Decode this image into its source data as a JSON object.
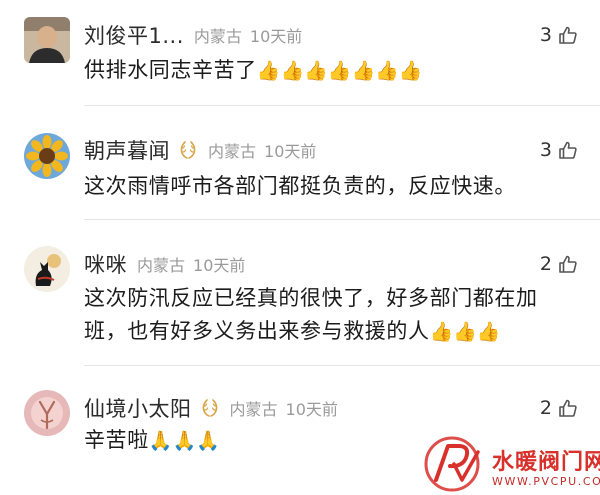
{
  "comments": [
    {
      "name": "刘俊平1...",
      "has_badge": false,
      "location": "内蒙古",
      "time": "10天前",
      "likes": "3",
      "text": "供排水同志辛苦了",
      "emoji": "👍👍👍👍👍👍👍"
    },
    {
      "name": "朝声暮闻",
      "has_badge": true,
      "location": "内蒙古",
      "time": "10天前",
      "likes": "3",
      "text": "这次雨情呼市各部门都挺负责的，反应快速。",
      "emoji": ""
    },
    {
      "name": "咪咪",
      "has_badge": false,
      "location": "内蒙古",
      "time": "10天前",
      "likes": "2",
      "text": "这次防汛反应已经真的很快了，好多部门都在加班，也有好多义务出来参与救援的人",
      "emoji": "👍👍👍"
    },
    {
      "name": "仙境小太阳",
      "has_badge": true,
      "location": "内蒙古",
      "time": "10天前",
      "likes": "2",
      "text": "辛苦啦",
      "emoji": "🙏🙏🙏"
    }
  ],
  "watermark": {
    "brand": "水暖阀门网",
    "url": "WWW.PVCPU.COM"
  },
  "colors": {
    "meta_gray": "#9a9a9a",
    "divider": "#e6e6e6",
    "badge_gold": "#d8a64a",
    "watermark_red": "#d8302b"
  }
}
